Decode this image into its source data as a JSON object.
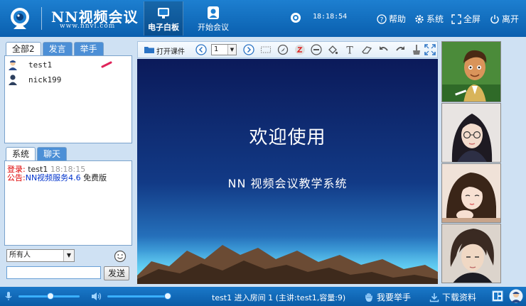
{
  "header": {
    "app_title": "NN视频会议",
    "app_url": "www.nnvl.com",
    "nav": [
      {
        "label": "电子白板",
        "active": true
      },
      {
        "label": "开始会议",
        "active": false
      }
    ],
    "time": "18:18:54",
    "links": {
      "help": "帮助",
      "system": "系统",
      "fullscreen": "全屏",
      "leave": "离开"
    }
  },
  "user_panel": {
    "tabs": [
      "全部2",
      "发言",
      "举手"
    ],
    "users": [
      {
        "name": "test1",
        "icon": "admin-user-icon"
      },
      {
        "name": "nick199",
        "icon": "user-icon"
      }
    ]
  },
  "chat_panel": {
    "tabs": [
      "系统",
      "聊天"
    ],
    "messages": [
      {
        "label": "登录:",
        "user": "test1",
        "time": "18:18:15"
      },
      {
        "label": "公告:",
        "text": "NN视频服务4.6",
        "extra": "免费版"
      }
    ],
    "recipient": "所有人",
    "send_label": "发送"
  },
  "toolbar": {
    "open_courseware": "打开课件",
    "page": "1"
  },
  "slide": {
    "title": "欢迎使用",
    "subtitle": "NN 视频会议教学系统"
  },
  "footer": {
    "status": "test1 进入房间 1 (主讲:test1,容量:9)",
    "raise_hand": "我要举手",
    "download": "下载资料"
  },
  "colors": {
    "header": "#0a5fae",
    "slide_top": "#0b1a5a",
    "slide_bottom": "#2a7ec8",
    "accent_cyan": "#3ab0ff"
  }
}
